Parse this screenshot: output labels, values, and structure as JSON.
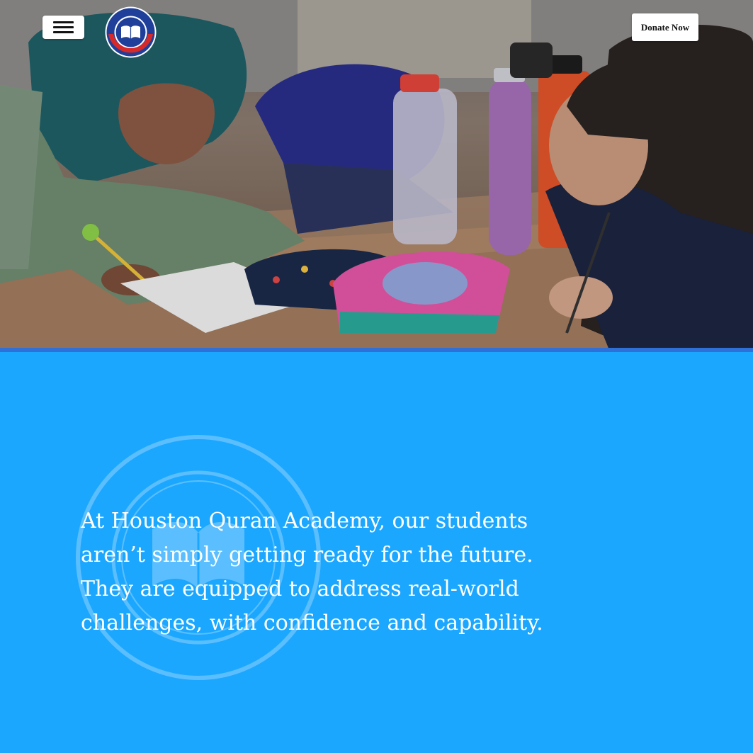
{
  "header": {
    "menu_icon": "hamburger-menu-icon",
    "logo_icon": "academy-logo-icon",
    "donate_label": "Donate Now"
  },
  "hero": {
    "image": "students-writing-in-classroom-photo"
  },
  "mission": {
    "text": "At Houston Quran Academy, our students aren’t simply getting ready for the future. They are equipped to address real-world challenges, with confidence and capability.",
    "watermark_icon": "academy-seal-watermark-icon"
  },
  "colors": {
    "section_bg": "#1ca7ff",
    "hero_divider": "#2f6fd8",
    "logo_blue": "#1f3f9a",
    "logo_red": "#d62a2a"
  }
}
